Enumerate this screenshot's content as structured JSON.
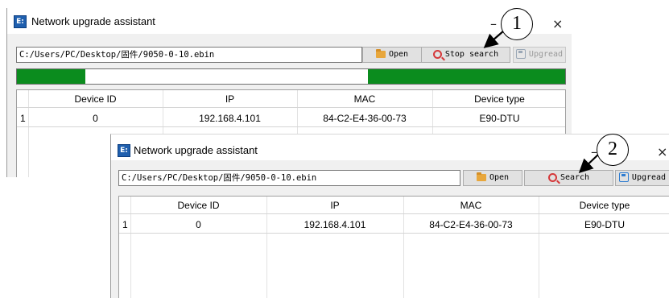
{
  "window_title": "Network upgrade assistant",
  "app_icon_label": "E:",
  "file_path": "C:/Users/PC/Desktop/固件/9050-0-10.ebin",
  "buttons": {
    "open": "Open",
    "stop_search": "Stop search",
    "search": "Search",
    "upgrade": "Upgread"
  },
  "window_controls": {
    "minimize": "–",
    "close": "×"
  },
  "progress_fill": [
    {
      "start": 0.0,
      "end": 0.125
    },
    {
      "start": 0.64,
      "end": 1.0
    }
  ],
  "table": {
    "columns": [
      "Device ID",
      "IP",
      "MAC",
      "Device type"
    ],
    "rows": [
      {
        "index": "1",
        "cells": [
          "0",
          "192.168.4.101",
          "84-C2-E4-36-00-73",
          "E90-DTU"
        ]
      }
    ]
  },
  "callouts": [
    "1",
    "2"
  ],
  "colors": {
    "progress": "#0b8c1e",
    "search_icon": "#d5383a",
    "app_icon": "#1f5fae"
  }
}
